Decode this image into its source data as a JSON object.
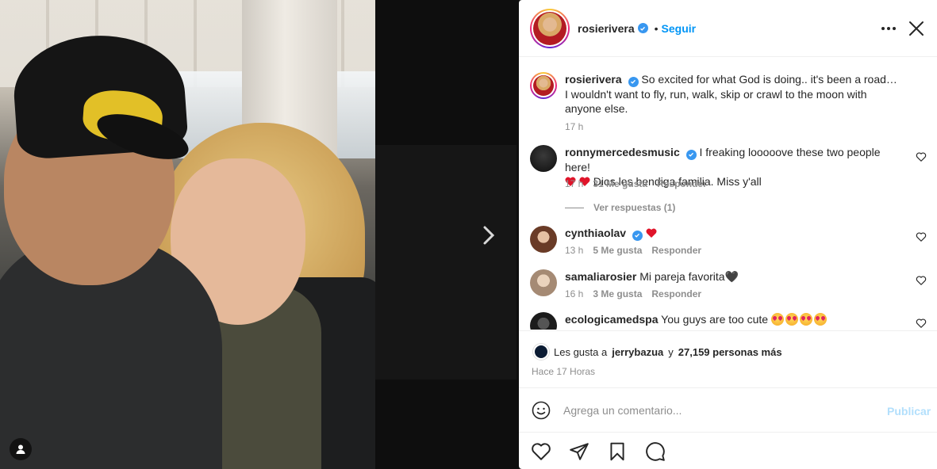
{
  "post": {
    "author": "rosierivera",
    "follow_label": "Seguir",
    "separator": "•",
    "caption": "So excited for what God is doing.. it's been a road… I wouldn't want to fly, run, walk, skip or crawl to the moon with anyone else.",
    "caption_time": "17 h"
  },
  "comments": [
    {
      "user": "ronnymercedesmusic",
      "verified": true,
      "text_1": "I freaking looooove these two people here!",
      "text_2": "Dios les bendiga familia. Miss y'all",
      "time": "17 h",
      "likes": "31 Me gusta",
      "reply": "Responder",
      "view_replies": "Ver respuestas (1)"
    },
    {
      "user": "cynthiaolav",
      "verified": true,
      "text": "",
      "time": "13 h",
      "likes": "5 Me gusta",
      "reply": "Responder"
    },
    {
      "user": "samaliarosier",
      "verified": false,
      "text": "Mi pareja favorita🖤",
      "time": "16 h",
      "likes": "3 Me gusta",
      "reply": "Responder"
    },
    {
      "user": "ecologicamedspa",
      "verified": false,
      "text": "You guys are too cute"
    }
  ],
  "likes": {
    "prefix": "Les gusta a",
    "user": "jerrybazua",
    "connector": "y",
    "others": "27,159 personas más"
  },
  "timestamp": "Hace 17 Horas",
  "add_comment": {
    "placeholder": "Agrega un comentario...",
    "publish": "Publicar"
  },
  "colors": {
    "accent": "#0095f6",
    "publish_disabled": "#b2dffc",
    "verified": "#3897f0",
    "heart_red": "#ed4956"
  },
  "icons": [
    "user-tag-icon",
    "chevron-right-icon",
    "more-options-icon",
    "close-icon",
    "verified-icon",
    "heart-icon",
    "emoji-icon",
    "share-icon",
    "bookmark-icon",
    "comment-icon"
  ]
}
